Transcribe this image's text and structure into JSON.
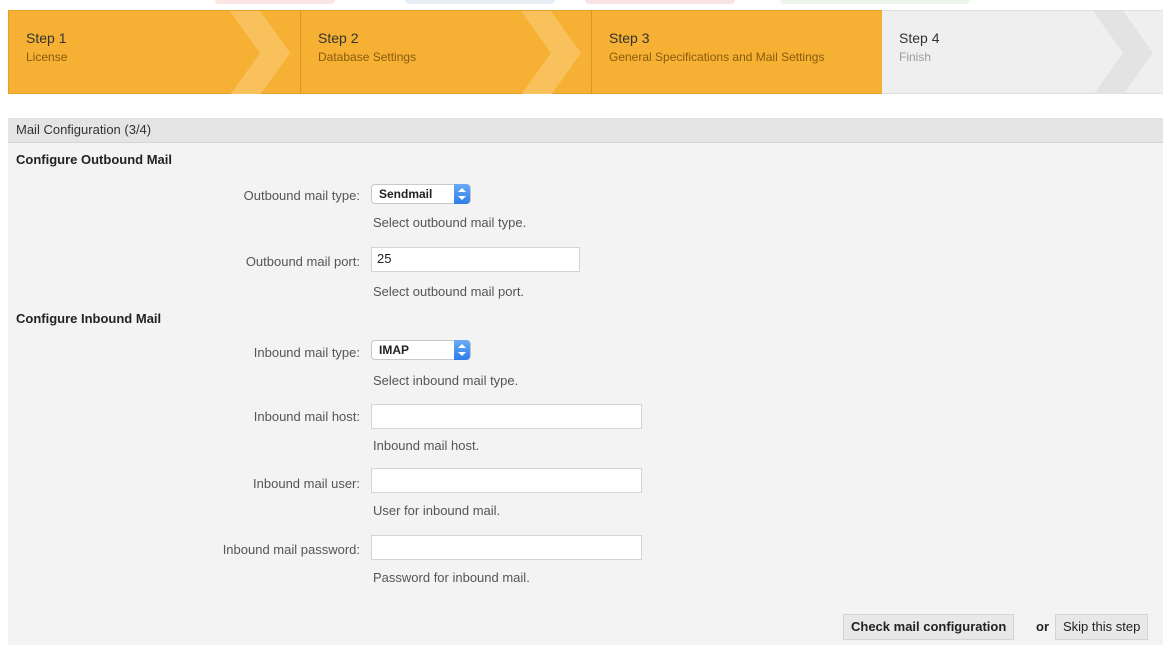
{
  "steps": [
    {
      "number": "Step 1",
      "title": "License",
      "state": "done"
    },
    {
      "number": "Step 2",
      "title": "Database Settings",
      "state": "done"
    },
    {
      "number": "Step 3",
      "title": "General Specifications and Mail Settings",
      "state": "current"
    },
    {
      "number": "Step 4",
      "title": "Finish",
      "state": "pending"
    }
  ],
  "panel": {
    "header": "Mail Configuration (3/4)",
    "outbound": {
      "title": "Configure Outbound Mail",
      "type_label": "Outbound mail type:",
      "type_value": "Sendmail",
      "type_hint": "Select outbound mail type.",
      "port_label": "Outbound mail port:",
      "port_value": "25",
      "port_hint": "Select outbound mail port."
    },
    "inbound": {
      "title": "Configure Inbound Mail",
      "type_label": "Inbound mail type:",
      "type_value": "IMAP",
      "type_hint": "Select inbound mail type.",
      "host_label": "Inbound mail host:",
      "host_value": "",
      "host_hint": "Inbound mail host.",
      "user_label": "Inbound mail user:",
      "user_value": "",
      "user_hint": "User for inbound mail.",
      "password_label": "Inbound mail password:",
      "password_value": "",
      "password_hint": "Password for inbound mail."
    },
    "actions": {
      "check_label": "Check mail configuration",
      "or_label": "or",
      "skip_label": "Skip this step"
    }
  },
  "colors": {
    "active_step": "#f6b135",
    "inactive_step": "#efefef",
    "select_arrow": "#2d7ee8"
  }
}
